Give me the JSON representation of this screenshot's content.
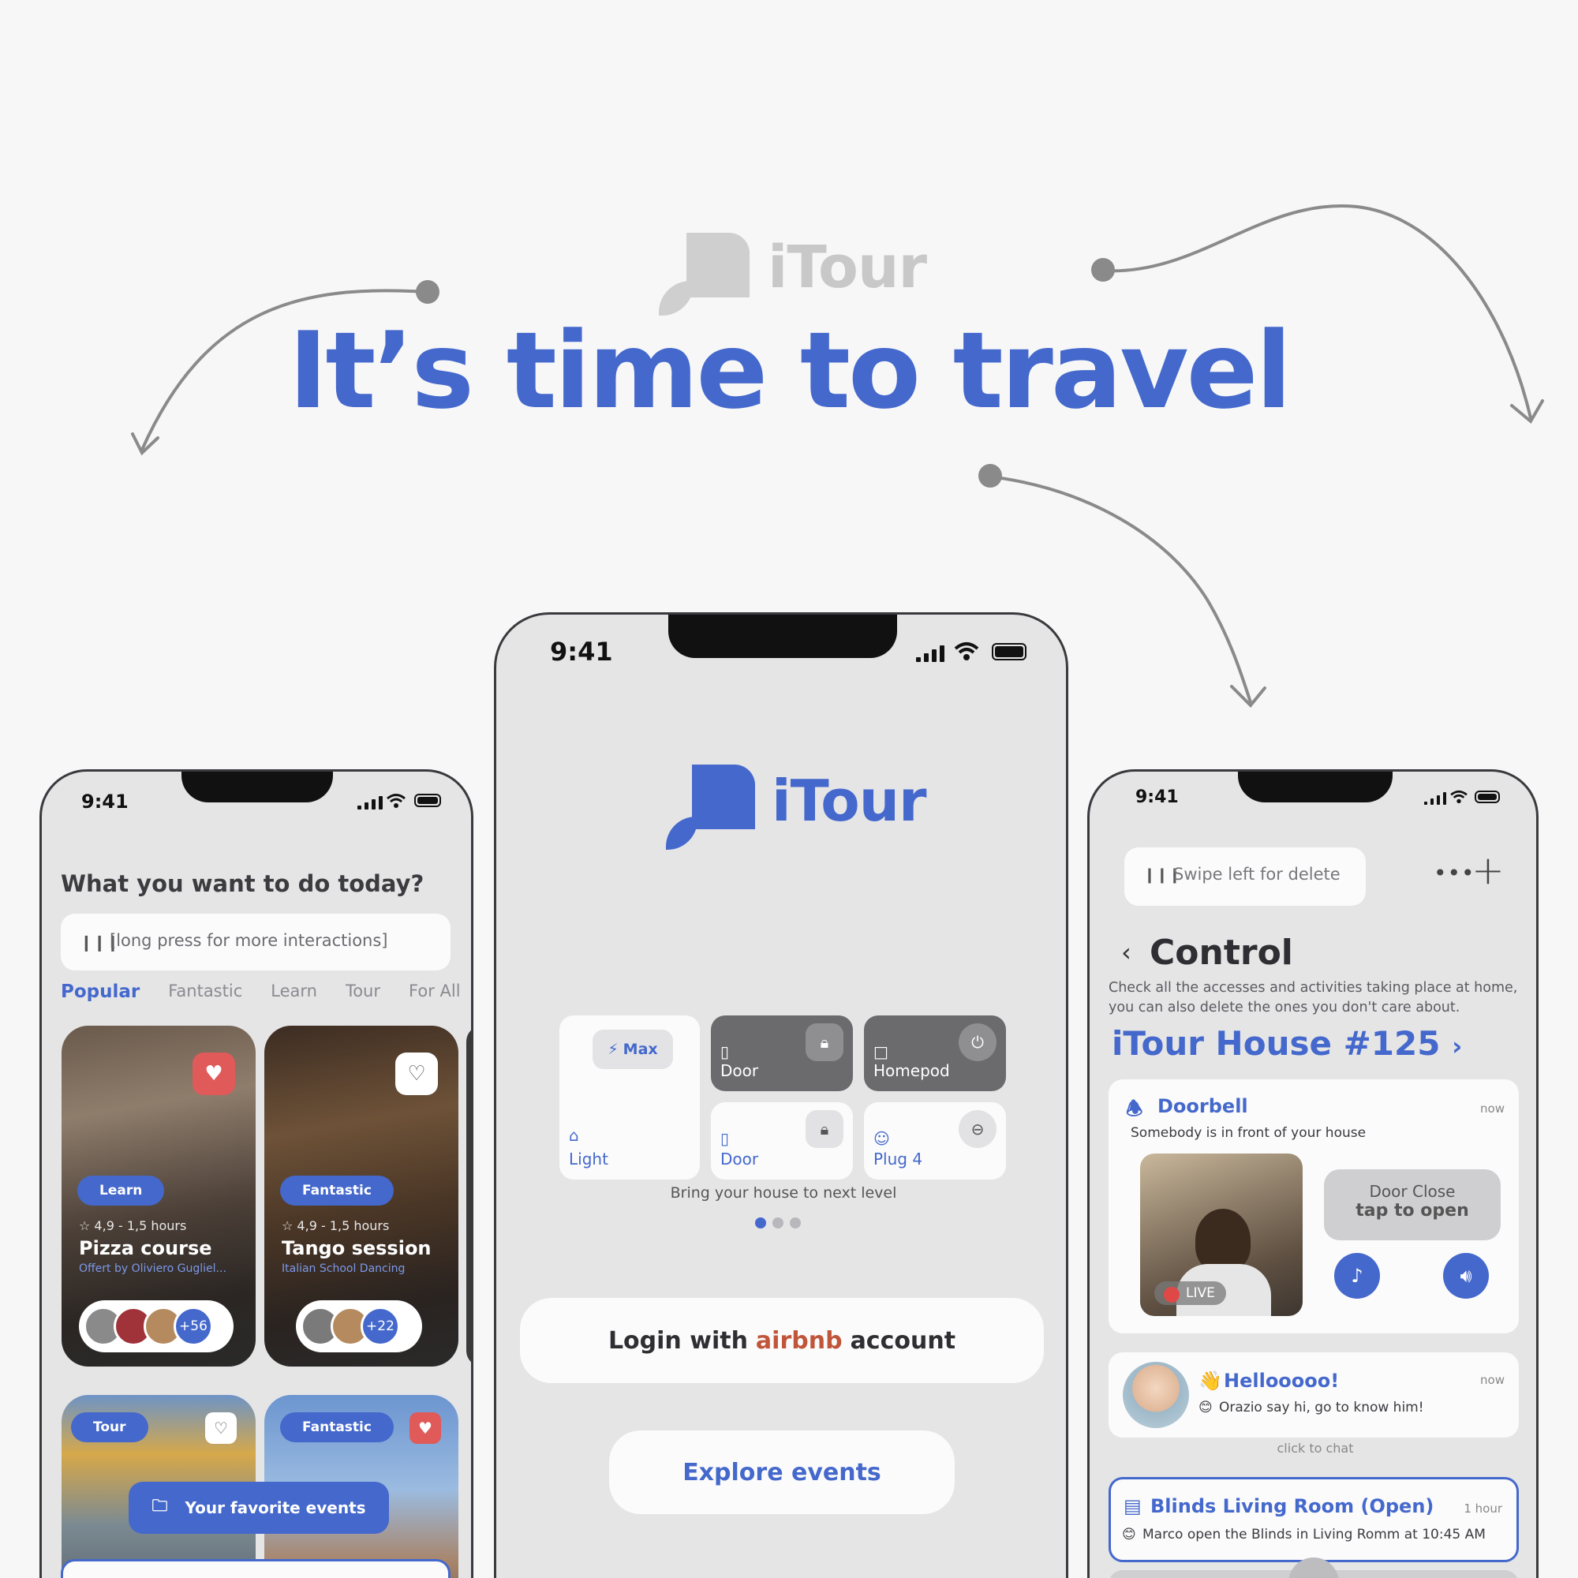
{
  "brand": {
    "name": "iTour"
  },
  "headline": "It’s time to travel",
  "left_phone": {
    "time": "9:41",
    "title": "What you want to do today?",
    "search_placeholder": "[long press for more interactions]",
    "tabs": [
      "Popular",
      "Fantastic",
      "Learn",
      "Tour",
      "For All"
    ],
    "cards": [
      {
        "tag": "Learn",
        "meta": "☆ 4,9 - 1,5 hours",
        "title": "Pizza course",
        "subtitle": "Offert by Oliviero Gugliel...",
        "count": "+56",
        "favorited": true
      },
      {
        "tag": "Fantastic",
        "meta": "☆ 4,9 - 1,5 hours",
        "title": "Tango session",
        "subtitle": "Italian School Dancing",
        "count": "+22",
        "favorited": false
      },
      {
        "tag": "Tour",
        "favorited": false
      },
      {
        "tag": "Fantastic",
        "favorited": true
      }
    ],
    "fab_label": "Your favorite events"
  },
  "center_phone": {
    "time": "9:41",
    "tiles": {
      "light_badge": "Max",
      "light": "Light",
      "door1": "Door",
      "homepod": "Homepod",
      "door2": "Door",
      "plug": "Plug 4"
    },
    "tagline": "Bring your house to next level",
    "login": {
      "prefix": "Login with",
      "brand": "airbnb",
      "suffix": "account"
    },
    "explore": "Explore events"
  },
  "right_phone": {
    "time": "9:41",
    "swipe_hint": "Swipe left for delete",
    "title": "Control",
    "description": "Check all the accesses and activities taking place at home, you can also delete the ones you don't care about.",
    "house": "iTour House #125",
    "doorbell": {
      "title": "Doorbell",
      "time": "now",
      "text": "Somebody is in front of your house",
      "live": "LIVE",
      "door_state": "Door Close",
      "door_action": "tap to open"
    },
    "message": {
      "title": "Hellooooo!",
      "time": "now",
      "text": "Orazio say hi, go to know him!",
      "hint": "click to chat"
    },
    "blinds": {
      "title": "Blinds Living Room (Open)",
      "time": "1 hour",
      "text": "Marco open the Blinds in Living Romm at 10:45 AM"
    }
  },
  "colors": {
    "accent": "#4468cc",
    "airbnb": "#c0553a",
    "favorite": "#e05a5a",
    "background": "#f7f7f8"
  }
}
